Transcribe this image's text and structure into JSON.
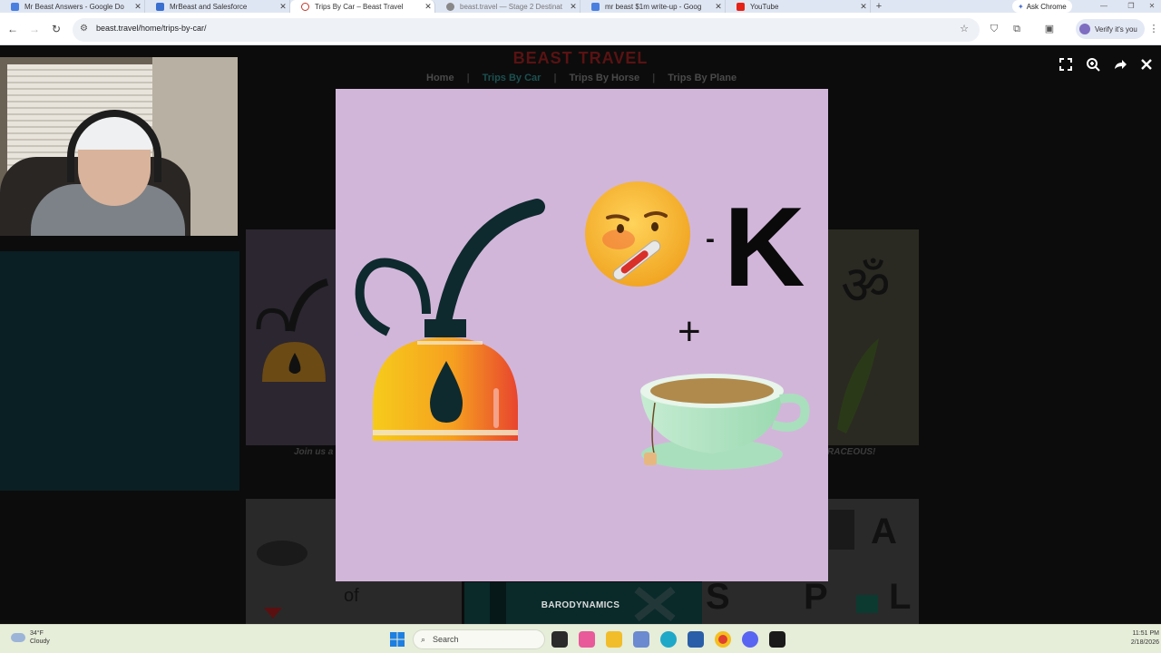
{
  "browser": {
    "tabs": [
      {
        "label": "Mr Beast Answers - Google Do",
        "icon": "google-docs-icon",
        "active": false
      },
      {
        "label": "MrBeast and Salesforce",
        "icon": "salesforce-icon",
        "active": false
      },
      {
        "label": "Trips By Car – Beast Travel",
        "icon": "site-icon",
        "active": true
      },
      {
        "label": "beast.travel — Stage 2 Destinat",
        "icon": "globe-icon",
        "active": false
      },
      {
        "label": "mr beast $1m write-up - Goog",
        "icon": "google-docs-icon",
        "active": false
      },
      {
        "label": "YouTube",
        "icon": "youtube-icon",
        "active": false
      }
    ],
    "new_tab_glyph": "+",
    "ask_chrome": "Ask Chrome",
    "url": "beast.travel/home/trips-by-car/",
    "verify_label": "Verify it's you"
  },
  "site": {
    "title": "BEAST TRAVEL",
    "nav": [
      "Home",
      "Trips By Car",
      "Trips By Horse",
      "Trips By Plane"
    ],
    "nav_separator": "|",
    "current_nav": "Trips By Car",
    "caption_left": "Join us a",
    "caption_right": "RACEOUS!",
    "background_word": "of"
  },
  "viewer": {
    "puzzle": {
      "minus_sign": "-",
      "letter": "K",
      "plus_sign": "+"
    },
    "brand": "BARODYNAMICS",
    "controls": [
      "fullscreen-icon",
      "zoom-icon",
      "share-icon",
      "close-icon"
    ]
  },
  "background_puzzle": {
    "letter_a": "A",
    "letter_s": "S",
    "letter_p": "P",
    "letter_l": "L",
    "om_symbol": "ॐ"
  },
  "taskbar": {
    "temperature": "34°F",
    "weather": "Cloudy",
    "search_placeholder": "Search",
    "time": "11:51 PM",
    "date": "2/18/2026"
  },
  "colors": {
    "overlay_bg": "#d2b6da",
    "brand_red": "#5a1212",
    "teal": "#1c5050",
    "taskbar_bg": "#e6edd9"
  }
}
